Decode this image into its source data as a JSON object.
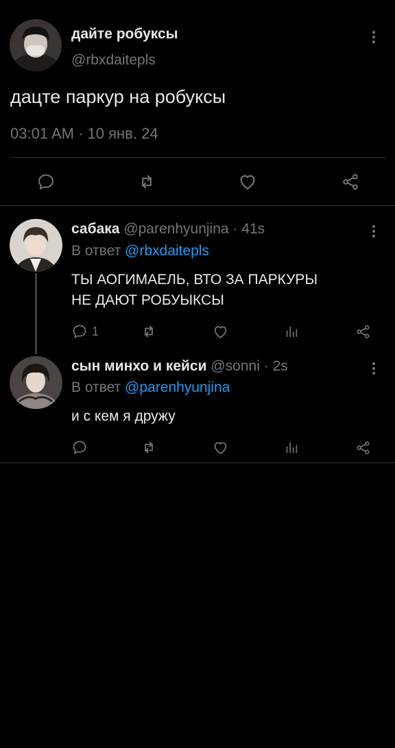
{
  "main_tweet": {
    "name": "дайте робуксы",
    "handle": "@rbxdaitepls",
    "text": "дацте паркур на робуксы",
    "time": "03:01 AM",
    "sep": "·",
    "date": "10 янв. 24",
    "icons": [
      "comment-icon",
      "retweet-icon",
      "like-icon",
      "share-icon"
    ]
  },
  "replies": [
    {
      "name": "сабака",
      "handle": "@parenhyunjina",
      "sep": "·",
      "time": "41s",
      "reply_prefix": "В ответ",
      "reply_to": "@rbxdaitepls",
      "text_line1": "ТЫ АОГИМАЕЛЬ, ВТО ЗА ПАРКУРЫ",
      "text_line2": "НЕ ДАЮТ РОБУЫКСЫ",
      "reply_count": "1"
    },
    {
      "name": "сын минхо и кейси",
      "handle": "@sonni",
      "sep": "·",
      "time": "2s",
      "reply_prefix": "В ответ",
      "reply_to": "@parenhyunjina",
      "text_line1": "и с кем я дружу",
      "reply_count": ""
    }
  ],
  "colors": {
    "background": "#000000",
    "text": "#e7e9ea",
    "muted": "#71767b",
    "link": "#1d9bf0",
    "divider": "#2f3336"
  }
}
